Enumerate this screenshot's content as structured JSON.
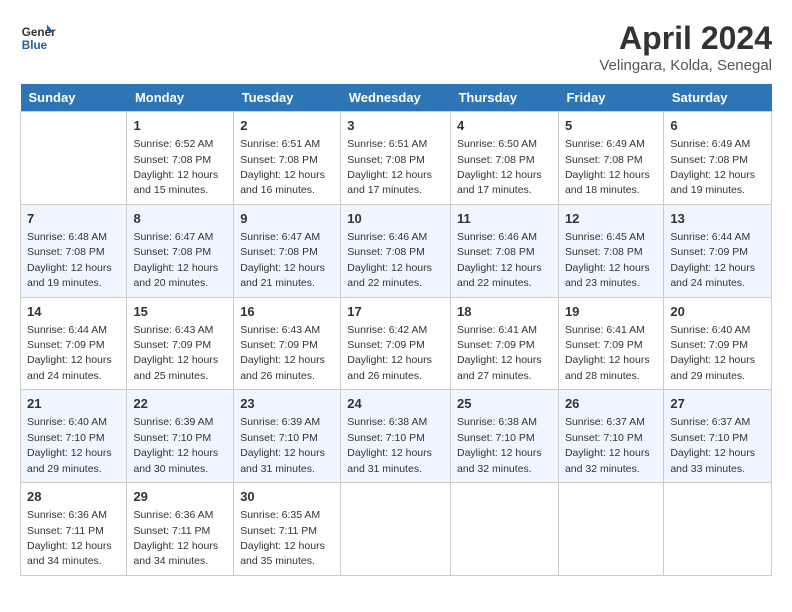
{
  "logo": {
    "line1": "General",
    "line2": "Blue"
  },
  "title": "April 2024",
  "subtitle": "Velingara, Kolda, Senegal",
  "headers": [
    "Sunday",
    "Monday",
    "Tuesday",
    "Wednesday",
    "Thursday",
    "Friday",
    "Saturday"
  ],
  "weeks": [
    [
      {
        "num": "",
        "sunrise": "",
        "sunset": "",
        "daylight": ""
      },
      {
        "num": "1",
        "sunrise": "Sunrise: 6:52 AM",
        "sunset": "Sunset: 7:08 PM",
        "daylight": "Daylight: 12 hours and 15 minutes."
      },
      {
        "num": "2",
        "sunrise": "Sunrise: 6:51 AM",
        "sunset": "Sunset: 7:08 PM",
        "daylight": "Daylight: 12 hours and 16 minutes."
      },
      {
        "num": "3",
        "sunrise": "Sunrise: 6:51 AM",
        "sunset": "Sunset: 7:08 PM",
        "daylight": "Daylight: 12 hours and 17 minutes."
      },
      {
        "num": "4",
        "sunrise": "Sunrise: 6:50 AM",
        "sunset": "Sunset: 7:08 PM",
        "daylight": "Daylight: 12 hours and 17 minutes."
      },
      {
        "num": "5",
        "sunrise": "Sunrise: 6:49 AM",
        "sunset": "Sunset: 7:08 PM",
        "daylight": "Daylight: 12 hours and 18 minutes."
      },
      {
        "num": "6",
        "sunrise": "Sunrise: 6:49 AM",
        "sunset": "Sunset: 7:08 PM",
        "daylight": "Daylight: 12 hours and 19 minutes."
      }
    ],
    [
      {
        "num": "7",
        "sunrise": "Sunrise: 6:48 AM",
        "sunset": "Sunset: 7:08 PM",
        "daylight": "Daylight: 12 hours and 19 minutes."
      },
      {
        "num": "8",
        "sunrise": "Sunrise: 6:47 AM",
        "sunset": "Sunset: 7:08 PM",
        "daylight": "Daylight: 12 hours and 20 minutes."
      },
      {
        "num": "9",
        "sunrise": "Sunrise: 6:47 AM",
        "sunset": "Sunset: 7:08 PM",
        "daylight": "Daylight: 12 hours and 21 minutes."
      },
      {
        "num": "10",
        "sunrise": "Sunrise: 6:46 AM",
        "sunset": "Sunset: 7:08 PM",
        "daylight": "Daylight: 12 hours and 22 minutes."
      },
      {
        "num": "11",
        "sunrise": "Sunrise: 6:46 AM",
        "sunset": "Sunset: 7:08 PM",
        "daylight": "Daylight: 12 hours and 22 minutes."
      },
      {
        "num": "12",
        "sunrise": "Sunrise: 6:45 AM",
        "sunset": "Sunset: 7:08 PM",
        "daylight": "Daylight: 12 hours and 23 minutes."
      },
      {
        "num": "13",
        "sunrise": "Sunrise: 6:44 AM",
        "sunset": "Sunset: 7:09 PM",
        "daylight": "Daylight: 12 hours and 24 minutes."
      }
    ],
    [
      {
        "num": "14",
        "sunrise": "Sunrise: 6:44 AM",
        "sunset": "Sunset: 7:09 PM",
        "daylight": "Daylight: 12 hours and 24 minutes."
      },
      {
        "num": "15",
        "sunrise": "Sunrise: 6:43 AM",
        "sunset": "Sunset: 7:09 PM",
        "daylight": "Daylight: 12 hours and 25 minutes."
      },
      {
        "num": "16",
        "sunrise": "Sunrise: 6:43 AM",
        "sunset": "Sunset: 7:09 PM",
        "daylight": "Daylight: 12 hours and 26 minutes."
      },
      {
        "num": "17",
        "sunrise": "Sunrise: 6:42 AM",
        "sunset": "Sunset: 7:09 PM",
        "daylight": "Daylight: 12 hours and 26 minutes."
      },
      {
        "num": "18",
        "sunrise": "Sunrise: 6:41 AM",
        "sunset": "Sunset: 7:09 PM",
        "daylight": "Daylight: 12 hours and 27 minutes."
      },
      {
        "num": "19",
        "sunrise": "Sunrise: 6:41 AM",
        "sunset": "Sunset: 7:09 PM",
        "daylight": "Daylight: 12 hours and 28 minutes."
      },
      {
        "num": "20",
        "sunrise": "Sunrise: 6:40 AM",
        "sunset": "Sunset: 7:09 PM",
        "daylight": "Daylight: 12 hours and 29 minutes."
      }
    ],
    [
      {
        "num": "21",
        "sunrise": "Sunrise: 6:40 AM",
        "sunset": "Sunset: 7:10 PM",
        "daylight": "Daylight: 12 hours and 29 minutes."
      },
      {
        "num": "22",
        "sunrise": "Sunrise: 6:39 AM",
        "sunset": "Sunset: 7:10 PM",
        "daylight": "Daylight: 12 hours and 30 minutes."
      },
      {
        "num": "23",
        "sunrise": "Sunrise: 6:39 AM",
        "sunset": "Sunset: 7:10 PM",
        "daylight": "Daylight: 12 hours and 31 minutes."
      },
      {
        "num": "24",
        "sunrise": "Sunrise: 6:38 AM",
        "sunset": "Sunset: 7:10 PM",
        "daylight": "Daylight: 12 hours and 31 minutes."
      },
      {
        "num": "25",
        "sunrise": "Sunrise: 6:38 AM",
        "sunset": "Sunset: 7:10 PM",
        "daylight": "Daylight: 12 hours and 32 minutes."
      },
      {
        "num": "26",
        "sunrise": "Sunrise: 6:37 AM",
        "sunset": "Sunset: 7:10 PM",
        "daylight": "Daylight: 12 hours and 32 minutes."
      },
      {
        "num": "27",
        "sunrise": "Sunrise: 6:37 AM",
        "sunset": "Sunset: 7:10 PM",
        "daylight": "Daylight: 12 hours and 33 minutes."
      }
    ],
    [
      {
        "num": "28",
        "sunrise": "Sunrise: 6:36 AM",
        "sunset": "Sunset: 7:11 PM",
        "daylight": "Daylight: 12 hours and 34 minutes."
      },
      {
        "num": "29",
        "sunrise": "Sunrise: 6:36 AM",
        "sunset": "Sunset: 7:11 PM",
        "daylight": "Daylight: 12 hours and 34 minutes."
      },
      {
        "num": "30",
        "sunrise": "Sunrise: 6:35 AM",
        "sunset": "Sunset: 7:11 PM",
        "daylight": "Daylight: 12 hours and 35 minutes."
      },
      {
        "num": "",
        "sunrise": "",
        "sunset": "",
        "daylight": ""
      },
      {
        "num": "",
        "sunrise": "",
        "sunset": "",
        "daylight": ""
      },
      {
        "num": "",
        "sunrise": "",
        "sunset": "",
        "daylight": ""
      },
      {
        "num": "",
        "sunrise": "",
        "sunset": "",
        "daylight": ""
      }
    ]
  ]
}
